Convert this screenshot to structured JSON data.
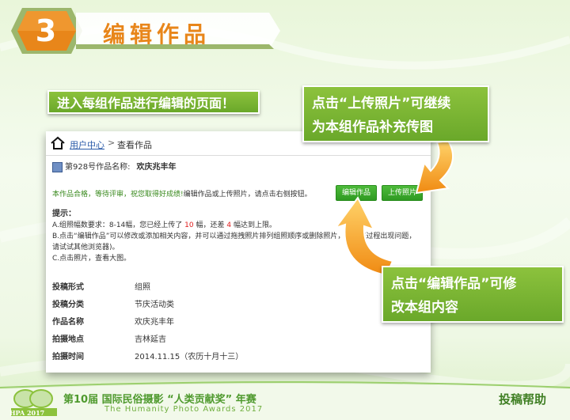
{
  "header": {
    "step_number": "3",
    "title": "编辑作品"
  },
  "callouts": {
    "intro": "进入每组作品进行编辑的页面！",
    "upload_quote": "上传照片",
    "upload_prefix": "点击“",
    "upload_suffix": "”可继续",
    "upload_line2": "为本组作品补充传图",
    "edit_prefix": "点击“",
    "edit_quote": "编辑作品",
    "edit_suffix": "”可修",
    "edit_line2": "改本组内容"
  },
  "breadcrumb": {
    "home": "用户中心",
    "sep": ">",
    "current": "查看作品"
  },
  "work": {
    "label": "第928号作品名称:",
    "name": "欢庆兆丰年"
  },
  "status": {
    "ok_text": "本作品合格，等待评审，祝您取得好成绩!",
    "hint": "编辑作品或上传照片，请点击右侧按钮。"
  },
  "buttons": {
    "edit": "编辑作品",
    "upload": "上传照片"
  },
  "tips": {
    "heading": "提示：",
    "line_a_pre": "A.组照幅数要求：8-14幅，您已经上传了",
    "uploaded": "10",
    "line_a_mid": "幅，还差",
    "remaining": "4",
    "line_a_post": "幅达到上限。",
    "line_b": "B.点击“编辑作品”可以修改或添加相关内容，并可以通过拖拽照片排列组照顺序或删除照片，如提交过程出现问题，",
    "line_b2": "请试试其他浏览器)。",
    "line_c": "C.点击照片，查看大图。"
  },
  "info": [
    {
      "label": "投稿形式",
      "value": "组照"
    },
    {
      "label": "投稿分类",
      "value": "节庆活动类"
    },
    {
      "label": "作品名称",
      "value": "欢庆兆丰年"
    },
    {
      "label": "拍摄地点",
      "value": "吉林延吉"
    },
    {
      "label": "拍摄时间",
      "value": "2014.11.15（农历十月十三）"
    }
  ],
  "footer": {
    "logo_text": "HPA 2017",
    "title": "第10届 国际民俗摄影 “人类贡献奖” 年赛",
    "subtitle": "The Humanity Photo Awards 2017",
    "help": "投稿帮助"
  },
  "colors": {
    "accent_orange": "#e8861a",
    "green": "#6aa82a",
    "link_blue": "#2a5aa8",
    "alert_red": "#e01b1b"
  }
}
